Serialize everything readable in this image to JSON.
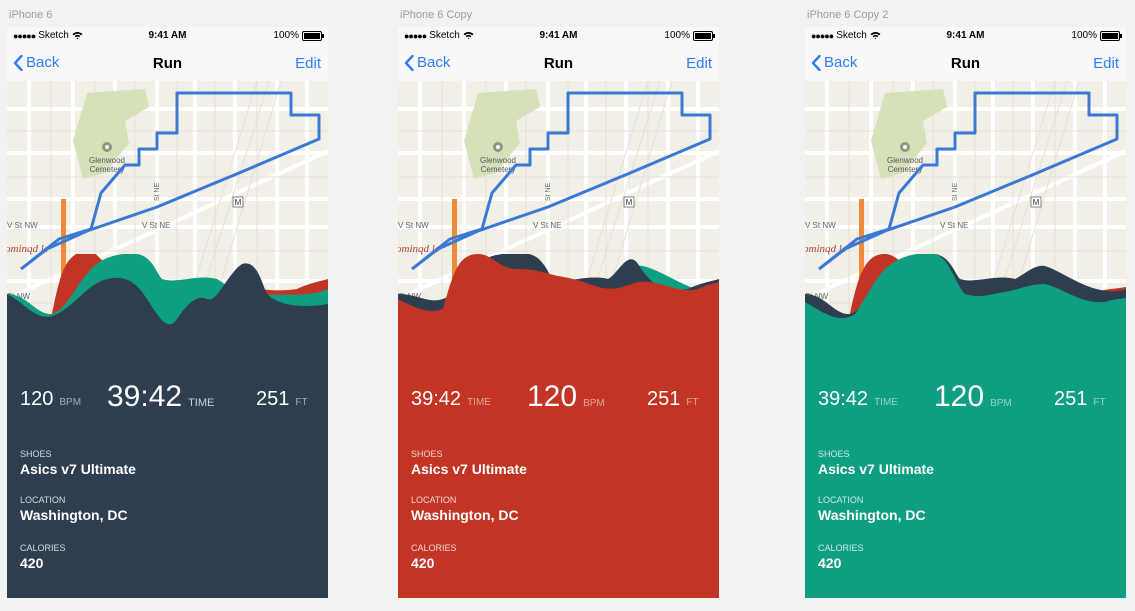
{
  "status_bar": {
    "carrier": "Sketch",
    "time": "9:41 AM",
    "battery": "100%"
  },
  "nav": {
    "back_label": "Back",
    "title": "Run",
    "edit_label": "Edit"
  },
  "map_labels": {
    "cemetery_line1": "Glenwood",
    "cemetery_line2": "Cemetery",
    "v_st_nw": "V St NW",
    "v_st_ne": "V St NE",
    "st_ne": "St NE",
    "bloomingdale": "ominqd le",
    "st_nw": "St NW",
    "metro": "M"
  },
  "artboards": [
    {
      "label": "iPhone 6",
      "panel_color": "#2e3e50",
      "stats": [
        {
          "value": "120",
          "unit": "BPM"
        },
        {
          "value": "39:42",
          "unit": "TIME"
        },
        {
          "value": "251",
          "unit": "FT"
        }
      ],
      "shoes_label": "SHOES",
      "shoes": "Asics v7 Ultimate",
      "location_label": "LOCATION",
      "location": "Washington, DC",
      "calories_label": "CALORIES",
      "calories": "420"
    },
    {
      "label": "iPhone 6 Copy",
      "panel_color": "#c23524",
      "stats": [
        {
          "value": "39:42",
          "unit": "TIME"
        },
        {
          "value": "120",
          "unit": "BPM"
        },
        {
          "value": "251",
          "unit": "FT"
        }
      ],
      "shoes_label": "SHOES",
      "shoes": "Asics v7 Ultimate",
      "location_label": "LOCATION",
      "location": "Washington, DC",
      "calories_label": "CALORIES",
      "calories": "420"
    },
    {
      "label": "iPhone 6 Copy 2",
      "panel_color": "#0e9e82",
      "stats": [
        {
          "value": "39:42",
          "unit": "TIME"
        },
        {
          "value": "120",
          "unit": "BPM"
        },
        {
          "value": "251",
          "unit": "FT"
        }
      ],
      "shoes_label": "SHOES",
      "shoes": "Asics v7 Ultimate",
      "location_label": "LOCATION",
      "location": "Washington, DC",
      "calories_label": "CALORIES",
      "calories": "420"
    }
  ],
  "colors": {
    "navy": "#2e3e50",
    "red": "#c23524",
    "teal": "#0e9e82",
    "ios_blue": "#2f7cf6",
    "route": "#3a78d6",
    "map_bg": "#f2efe7",
    "park": "#d5e1b8"
  }
}
